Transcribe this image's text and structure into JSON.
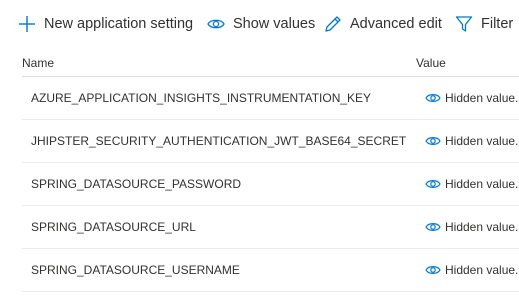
{
  "toolbar": {
    "new_setting_label": "New application setting",
    "show_values_label": "Show values",
    "advanced_edit_label": "Advanced edit",
    "filter_label": "Filter"
  },
  "table": {
    "columns": [
      "Name",
      "Value"
    ],
    "rows": [
      {
        "name": "AZURE_APPLICATION_INSIGHTS_INSTRUMENTATION_KEY",
        "value": "Hidden value."
      },
      {
        "name": "JHIPSTER_SECURITY_AUTHENTICATION_JWT_BASE64_SECRET",
        "value": "Hidden value."
      },
      {
        "name": "SPRING_DATASOURCE_PASSWORD",
        "value": "Hidden value."
      },
      {
        "name": "SPRING_DATASOURCE_URL",
        "value": "Hidden value."
      },
      {
        "name": "SPRING_DATASOURCE_USERNAME",
        "value": "Hidden value."
      }
    ]
  },
  "icons": {
    "new": "plus-icon",
    "show": "eye-icon",
    "advanced": "pencil-icon",
    "filter": "filter-icon",
    "hidden": "eye-icon"
  },
  "colors": {
    "accent": "#0078d4",
    "text": "#323130",
    "divider": "#edebe9"
  }
}
